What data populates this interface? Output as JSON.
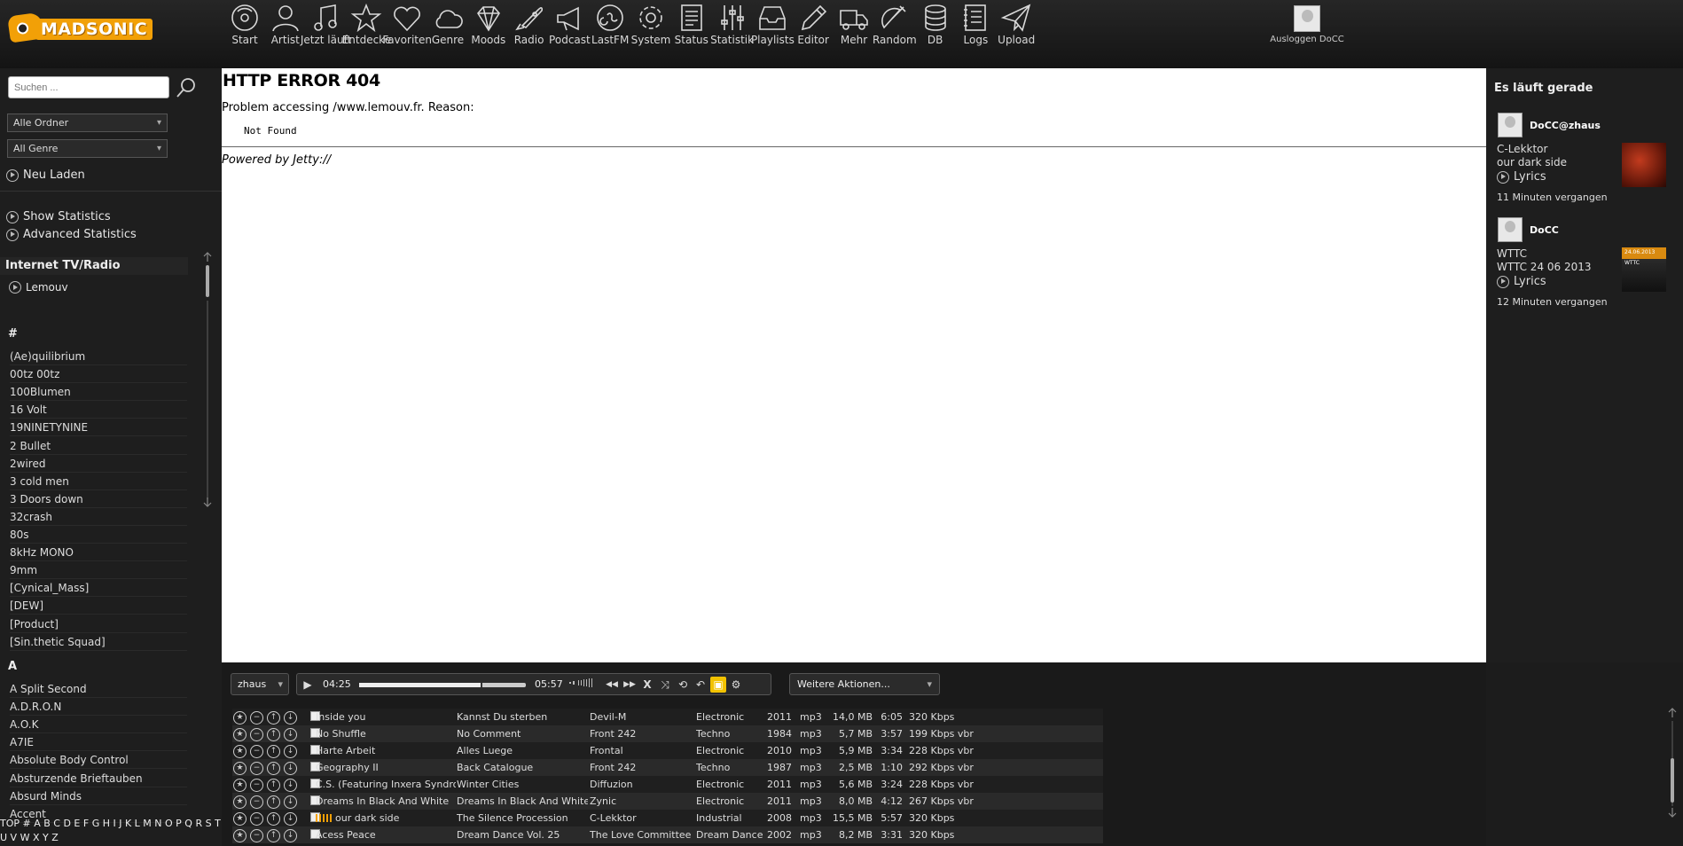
{
  "app": {
    "name": "MADSONIC"
  },
  "nav": [
    {
      "label": "Start",
      "icon": "disc-icon"
    },
    {
      "label": "Artist",
      "icon": "person-icon"
    },
    {
      "label": "Jetzt läuft",
      "icon": "music-note-icon"
    },
    {
      "label": "Entdecke",
      "icon": "star-icon"
    },
    {
      "label": "Favoriten",
      "icon": "heart-icon"
    },
    {
      "label": "Genre",
      "icon": "cloud-icon"
    },
    {
      "label": "Moods",
      "icon": "diamond-icon"
    },
    {
      "label": "Radio",
      "icon": "rocket-icon"
    },
    {
      "label": "Podcast",
      "icon": "megaphone-icon"
    },
    {
      "label": "LastFM",
      "icon": "lastfm-icon"
    },
    {
      "label": "System",
      "icon": "gear-icon"
    },
    {
      "label": "Status",
      "icon": "document-icon"
    },
    {
      "label": "Statistik",
      "icon": "sliders-icon"
    },
    {
      "label": "Playlists",
      "icon": "inbox-icon"
    },
    {
      "label": "Editor",
      "icon": "pencil-icon"
    },
    {
      "label": "Mehr",
      "icon": "truck-icon"
    },
    {
      "label": "Random",
      "icon": "satellite-icon"
    },
    {
      "label": "DB",
      "icon": "database-icon"
    },
    {
      "label": "Logs",
      "icon": "notebook-icon"
    },
    {
      "label": "Upload",
      "icon": "paper-plane-icon"
    }
  ],
  "user": {
    "logout_label": "Ausloggen DoCC"
  },
  "sidebar": {
    "search_placeholder": "Suchen ...",
    "folder_select": "Alle Ordner",
    "genre_select": "All Genre",
    "reload": "Neu Laden",
    "show_statistics": "Show Statistics",
    "advanced_statistics": "Advanced Statistics",
    "radio_heading": "Internet TV/Radio",
    "radio_station": "Lemouv",
    "letter_hash": "#",
    "artists_hash": [
      "(Ae)quilibrium",
      "00tz 00tz",
      "100Blumen",
      "16 Volt",
      "19NINETYNINE",
      "2 Bullet",
      "2wired",
      "3 cold men",
      "3 Doors down",
      "32crash",
      "80s",
      "8kHz MONO",
      "9mm",
      "[Cynical_Mass]",
      "[DEW]",
      "[Product]",
      "[Sin.thetic Squad]"
    ],
    "letter_a": "A",
    "artists_a": [
      "A Split Second",
      "A.D.R.O.N",
      "A.O.K",
      "A7IE",
      "Absolute Body Control",
      "Absturzende Brieftauben",
      "Absurd Minds",
      "Accent"
    ],
    "alphabet": "TOP # A B C D E F G H I J K L M N O P Q R S T U V W X Y Z"
  },
  "main": {
    "error_title": "HTTP ERROR 404",
    "problem_line": "Problem accessing /www.lemouv.fr. Reason:",
    "reason": "Not Found",
    "powered_by": "Powered by Jetty://"
  },
  "now_playing": {
    "heading": "Es läuft gerade",
    "entries": [
      {
        "user": "DoCC@zhaus",
        "artist": "C-Lekktor",
        "title": "our dark side",
        "lyrics": "Lyrics",
        "ago": "11 Minuten vergangen",
        "cover_color": "#8a2a1a"
      },
      {
        "user": "DoCC",
        "artist": "WTTC",
        "title": "WTTC 24 06 2013",
        "lyrics": "Lyrics",
        "ago": "12 Minuten vergangen",
        "cover_text": "24.06.2013",
        "cover_sub": "WTTC",
        "cover_color": "#d98a10"
      }
    ]
  },
  "player": {
    "playlist_select": "zhaus",
    "elapsed": "04:25",
    "total": "05:57",
    "progress_fraction": 0.74,
    "actions_select": "Weitere Aktionen...",
    "shuffle_close": "X",
    "tracks": [
      {
        "title": "Inside you",
        "album": "Kannst Du sterben",
        "artist": "Devil-M",
        "genre": "Electronic",
        "year": "2011",
        "format": "mp3",
        "size": "14,0 MB",
        "duration": "6:05",
        "bitrate": "320 Kbps",
        "playing": false
      },
      {
        "title": "No Shuffle",
        "album": "No Comment",
        "artist": "Front 242",
        "genre": "Techno",
        "year": "1984",
        "format": "mp3",
        "size": "5,7 MB",
        "duration": "3:57",
        "bitrate": "199 Kbps vbr",
        "playing": false
      },
      {
        "title": "Harte Arbeit",
        "album": "Alles Luege",
        "artist": "Frontal",
        "genre": "Electronic",
        "year": "2010",
        "format": "mp3",
        "size": "5,9 MB",
        "duration": "3:34",
        "bitrate": "228 Kbps vbr",
        "playing": false
      },
      {
        "title": "Geography II",
        "album": "Back Catalogue",
        "artist": "Front 242",
        "genre": "Techno",
        "year": "1987",
        "format": "mp3",
        "size": "2,5 MB",
        "duration": "1:10",
        "bitrate": "292 Kbps vbr",
        "playing": false
      },
      {
        "title": "C.S. (Featuring Inxera Syndrome)",
        "album": "Winter Cities",
        "artist": "Diffuzion",
        "genre": "Electronic",
        "year": "2011",
        "format": "mp3",
        "size": "5,6 MB",
        "duration": "3:24",
        "bitrate": "228 Kbps vbr",
        "playing": false
      },
      {
        "title": "Dreams In Black And White",
        "album": "Dreams In Black And White EP",
        "artist": "Zynic",
        "genre": "Electronic",
        "year": "2011",
        "format": "mp3",
        "size": "8,0 MB",
        "duration": "4:12",
        "bitrate": "267 Kbps vbr",
        "playing": false
      },
      {
        "title": "our dark side",
        "album": "The Silence Procession",
        "artist": "C-Lekktor",
        "genre": "Industrial",
        "year": "2008",
        "format": "mp3",
        "size": "15,5 MB",
        "duration": "5:57",
        "bitrate": "320 Kbps",
        "playing": true
      },
      {
        "title": "Acess Peace",
        "album": "Dream Dance Vol. 25",
        "artist": "The Love Committee",
        "genre": "Dream Dance",
        "year": "2002",
        "format": "mp3",
        "size": "8,2 MB",
        "duration": "3:31",
        "bitrate": "320 Kbps",
        "playing": false
      }
    ]
  }
}
